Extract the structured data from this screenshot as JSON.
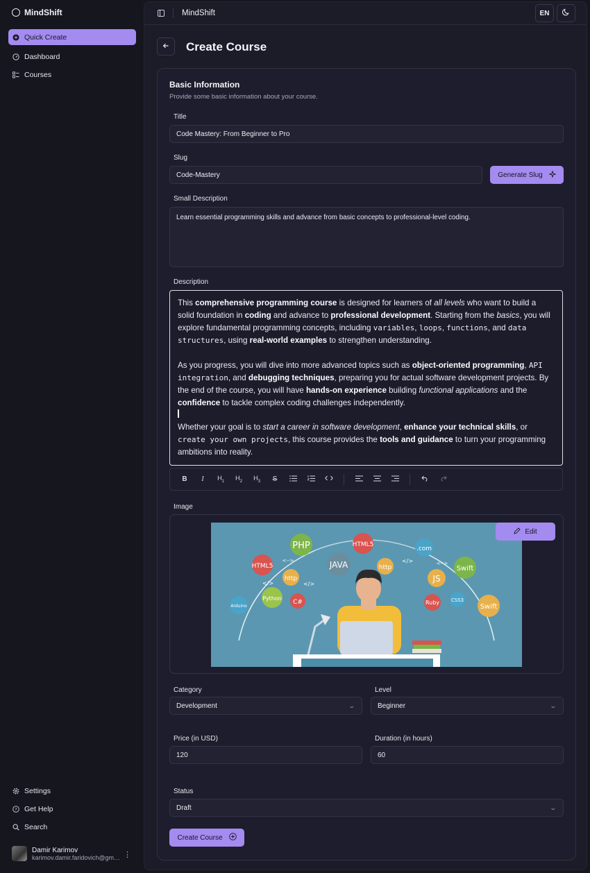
{
  "app": {
    "name": "MindShift"
  },
  "sidebar": {
    "items": [
      {
        "label": "Quick Create",
        "icon": "plus-circle-icon"
      },
      {
        "label": "Dashboard",
        "icon": "gauge-icon"
      },
      {
        "label": "Courses",
        "icon": "list-icon"
      }
    ],
    "bottom": [
      {
        "label": "Settings",
        "icon": "gear-icon"
      },
      {
        "label": "Get Help",
        "icon": "help-circle-icon"
      },
      {
        "label": "Search",
        "icon": "search-icon"
      }
    ],
    "user": {
      "name": "Damir Karimov",
      "email": "karimov.damir.faridovich@gmail.com"
    }
  },
  "topbar": {
    "title": "MindShift",
    "lang": "EN"
  },
  "page": {
    "title": "Create Course"
  },
  "form": {
    "section_title": "Basic Information",
    "section_subtitle": "Provide some basic information about your course.",
    "title_label": "Title",
    "title_value": "Code Mastery: From Beginner to Pro",
    "slug_label": "Slug",
    "slug_value": "Code-Mastery",
    "generate_slug": "Generate Slug",
    "small_desc_label": "Small Description",
    "small_desc_value": "Learn essential programming skills and advance from basic concepts to professional-level coding.",
    "desc_label": "Description",
    "image_label": "Image",
    "edit_label": "Edit",
    "category_label": "Category",
    "category_value": "Development",
    "level_label": "Level",
    "level_value": "Beginner",
    "price_label": "Price (in USD)",
    "price_value": "120",
    "duration_label": "Duration (in hours)",
    "duration_value": "60",
    "status_label": "Status",
    "status_value": "Draft",
    "submit_label": "Create Course"
  },
  "description": {
    "p1": [
      "This ",
      "comprehensive programming course",
      " is designed for learners of ",
      "all levels",
      " who want to build a solid foundation in ",
      "coding",
      " and advance to ",
      "professional development",
      ". Starting from the ",
      "basics",
      ", you will explore fundamental programming concepts, including ",
      "variables",
      ", ",
      "loops",
      ", ",
      "functions",
      ", and ",
      "data structures",
      ", using ",
      "real-world examples",
      " to strengthen understanding."
    ],
    "p2": [
      "As you progress, you will dive into more advanced topics such as ",
      "object-oriented programming",
      ", ",
      "API integration",
      ", and ",
      "debugging techniques",
      ", preparing you for actual software development projects. By the end of the course, you will have ",
      "hands-on experience",
      " building ",
      "functional applications",
      " and the ",
      "confidence",
      " to tackle complex coding challenges independently."
    ],
    "p3": [
      "Whether your goal is to ",
      "start a career in software development",
      ", ",
      "enhance your technical skills",
      ", or ",
      "create your own projects",
      ", this course provides the ",
      "tools and guidance",
      " to turn your programming ambitions into reality."
    ]
  },
  "toolbar_icons": [
    "bold-icon",
    "italic-icon",
    "h1-icon",
    "h2-icon",
    "h3-icon",
    "strikethrough-icon",
    "bullet-list-icon",
    "ordered-list-icon",
    "code-icon",
    "align-left-icon",
    "align-center-icon",
    "align-right-icon",
    "undo-icon",
    "redo-icon"
  ],
  "illustration": {
    "bubbles": [
      "PHP",
      "HTML5",
      "HTML5",
      "JAVA",
      "http",
      "http",
      ".com",
      "Swift",
      "JS",
      "Python",
      "C#",
      "Arduino",
      "Ruby",
      "CSS3",
      "Swift"
    ],
    "code_marks": [
      "<-->",
      "</>",
      "</>",
      "<-->",
      "</>"
    ]
  },
  "colors": {
    "accent": "#a48bf0",
    "background": "#16161f",
    "panel": "#1c1b28"
  }
}
